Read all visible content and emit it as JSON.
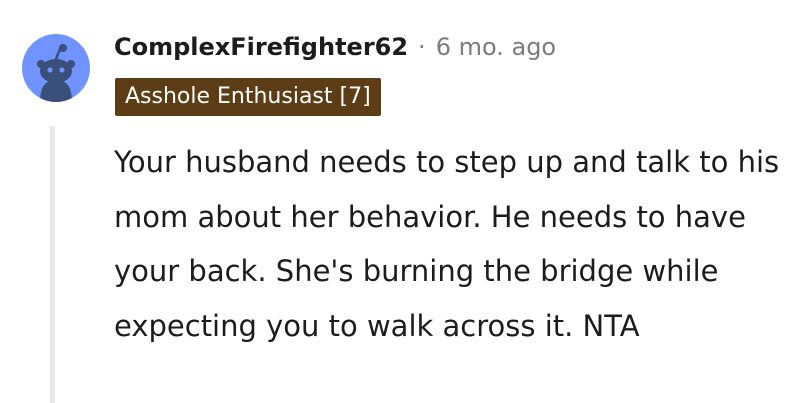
{
  "comment": {
    "author": "ComplexFirefighter62",
    "separator": "·",
    "timestamp": "6 mo. ago",
    "flair": "Asshole Enthusiast [7]",
    "body": "Your husband needs to step up and talk to his mom about her behavior. He needs to have your back. She's burning the bridge while expecting you to walk across it. NTA",
    "avatar_icon": "snoo-avatar-icon",
    "colors": {
      "avatar_bg": "#7193ff",
      "flair_bg": "#5c3d15",
      "flair_text": "#ffffff",
      "meta_text": "#7c7c7c",
      "thread_line": "#e9e9e9"
    }
  }
}
